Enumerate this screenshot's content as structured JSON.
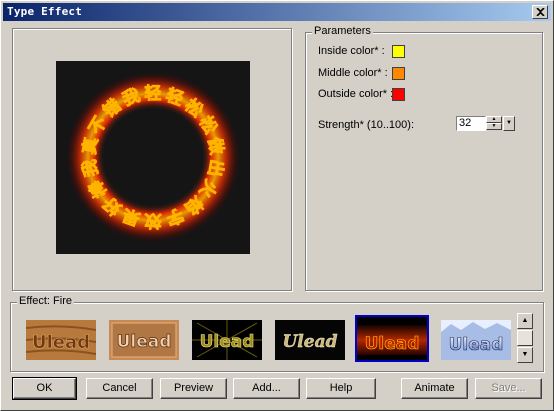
{
  "window": {
    "title": "Type Effect"
  },
  "preview": {
    "text": "我轻轻松松做出火焰字效果好棒我真不错"
  },
  "parameters": {
    "group_label": "Parameters",
    "inside_color": {
      "label": "Inside color* :",
      "color": "#ffff00"
    },
    "middle_color": {
      "label": "Middle color* :",
      "color": "#ff8800"
    },
    "outside_color": {
      "label": "Outside color* :",
      "color": "#ff0000"
    },
    "strength": {
      "label": "Strength* (10..100):",
      "value": "32"
    }
  },
  "effect": {
    "group_label": "Effect: Fire",
    "thumbnails": [
      {
        "name": "wood",
        "text": "Ulead",
        "selected": false
      },
      {
        "name": "bevel-brown",
        "text": "Ulead",
        "selected": false
      },
      {
        "name": "gold-glow",
        "text": "Ulead",
        "selected": false
      },
      {
        "name": "gold-italic",
        "text": "Ulead",
        "selected": false
      },
      {
        "name": "fire",
        "text": "Ulead",
        "selected": true
      },
      {
        "name": "ice",
        "text": "Ulead",
        "selected": false
      }
    ]
  },
  "buttons": {
    "ok": "OK",
    "cancel": "Cancel",
    "preview": "Preview",
    "add": "Add...",
    "help": "Help",
    "animate": "Animate",
    "save": "Save..."
  },
  "colors": {
    "title_start": "#0a246a",
    "title_end": "#a6caf0",
    "face": "#d4d0c8",
    "selection": "#0000cc"
  }
}
